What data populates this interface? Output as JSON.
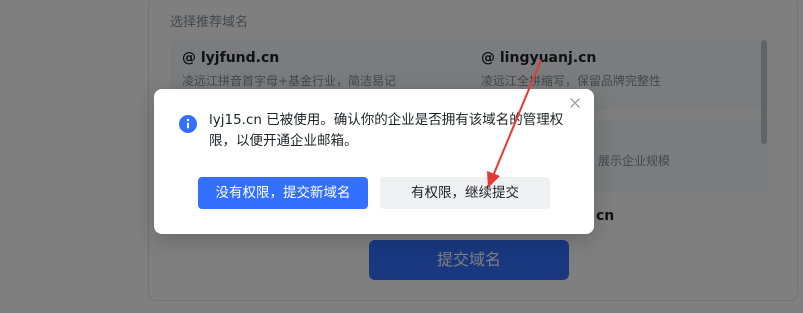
{
  "background": {
    "section_title": "选择推荐域名",
    "cards": [
      {
        "domain": "@ lyjfund.cn",
        "desc": "凌远江拼音首字母+基金行业，简洁易记"
      },
      {
        "domain": "@ lingyuanj.cn",
        "desc": "凌远江全拼缩写，保留品牌完整性"
      }
    ],
    "partial_desc": "展示企业规模",
    "partial_domain": "cn",
    "submit_label": "提交域名"
  },
  "dialog": {
    "message": "lyj15.cn 已被使用。确认你的企业是否拥有该域名的管理权限，以便开通企业邮箱。",
    "primary_label": "没有权限，提交新域名",
    "secondary_label": "有权限，继续提交"
  },
  "colors": {
    "primary": "#3370ff",
    "annotation": "#e53935"
  },
  "icons": {
    "info": "info-icon",
    "close": "close-icon"
  }
}
